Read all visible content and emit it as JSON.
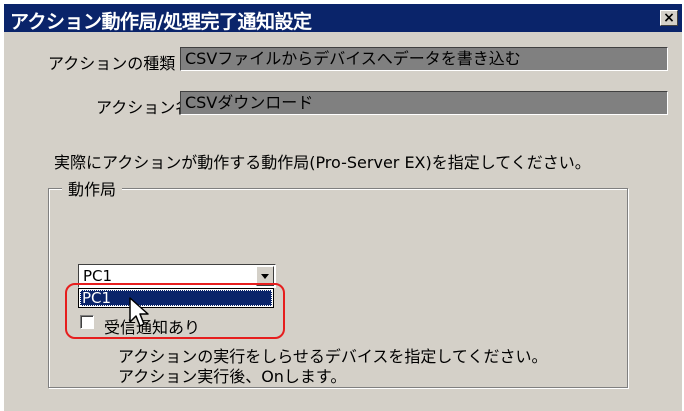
{
  "window": {
    "title": "アクション動作局/処理完了通知設定",
    "close_glyph": "×"
  },
  "fields": {
    "action_type_label": "アクションの種類",
    "action_type_value": "CSVファイルからデバイスへデータを書き込む",
    "action_name_label": "アクション名",
    "action_name_value": "CSVダウンロード"
  },
  "instruction": "実際にアクションが動作する動作局(Pro-Server EX)を指定してください。",
  "group": {
    "legend": "動作局",
    "combo_value": "PC1",
    "dropdown_options": [
      "PC1"
    ],
    "checkbox_label": "受信通知あり",
    "checkbox_checked": false,
    "note_line1": "アクションの実行をしらせるデバイスを指定してください。",
    "note_line2": "アクション実行後、Onします。"
  },
  "annotation": {
    "highlight_color": "#e61e1e"
  },
  "icons": {
    "cursor": "mouse-pointer-icon",
    "dropdown_arrow": "chevron-down-icon"
  }
}
